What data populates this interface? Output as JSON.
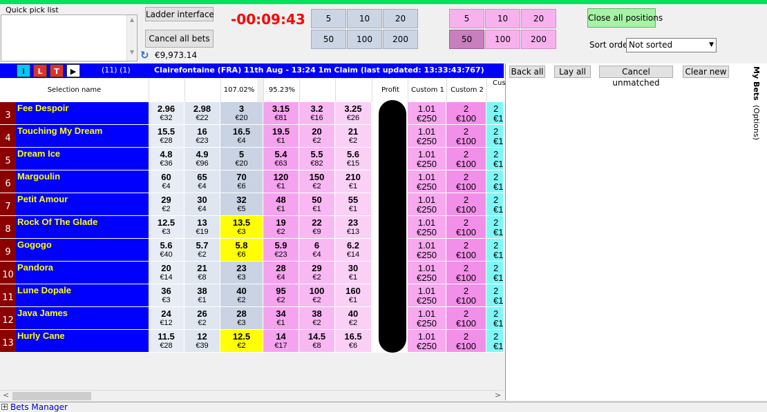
{
  "quick_pick": {
    "label": "Quick pick list"
  },
  "buttons": {
    "ladder": "Ladder interface",
    "cancel_all": "Cancel all bets",
    "close_all": "Close all positions"
  },
  "timer": "-00:09:43",
  "balance": "€9,973.14",
  "back_stakes": [
    "5",
    "10",
    "20",
    "50",
    "100",
    "200"
  ],
  "lay_stakes": [
    "5",
    "10",
    "20",
    "50",
    "100",
    "200"
  ],
  "lay_selected_index": 3,
  "sort": {
    "label": "Sort order",
    "value": "Not sorted"
  },
  "market": {
    "toolbar": [
      "i",
      "L",
      "T",
      "▶"
    ],
    "counts": "(11) (1)",
    "title": "Clairefontaine (FRA) 11th Aug - 13:24 1m Claim (last updated: 13:33:43:767)"
  },
  "columns": {
    "selection": "Selection name",
    "back_book": "107.02%",
    "lay_book": "95.23%",
    "profit": "Profit",
    "custom1": "Custom 1",
    "custom2": "Custom 2",
    "custom3": "Cus"
  },
  "runners": [
    {
      "num": "3",
      "name": "Fee Despoir",
      "back": [
        [
          "2.96",
          "€32"
        ],
        [
          "2.98",
          "€22"
        ],
        [
          "3",
          "€20"
        ]
      ],
      "lay": [
        [
          "3.15",
          "€81"
        ],
        [
          "3.2",
          "€16"
        ],
        [
          "3.25",
          "€26"
        ]
      ],
      "hl": false
    },
    {
      "num": "4",
      "name": "Touching My Dream",
      "back": [
        [
          "15.5",
          "€28"
        ],
        [
          "16",
          "€23"
        ],
        [
          "16.5",
          "€4"
        ]
      ],
      "lay": [
        [
          "19.5",
          "€1"
        ],
        [
          "20",
          "€2"
        ],
        [
          "21",
          "€2"
        ]
      ],
      "hl": false
    },
    {
      "num": "5",
      "name": "Dream Ice",
      "back": [
        [
          "4.8",
          "€36"
        ],
        [
          "4.9",
          "€96"
        ],
        [
          "5",
          "€20"
        ]
      ],
      "lay": [
        [
          "5.4",
          "€63"
        ],
        [
          "5.5",
          "€82"
        ],
        [
          "5.6",
          "€15"
        ]
      ],
      "hl": false
    },
    {
      "num": "6",
      "name": "Margoulin",
      "back": [
        [
          "60",
          "€4"
        ],
        [
          "65",
          "€4"
        ],
        [
          "70",
          "€6"
        ]
      ],
      "lay": [
        [
          "120",
          "€1"
        ],
        [
          "150",
          "€2"
        ],
        [
          "210",
          "€1"
        ]
      ],
      "hl": false
    },
    {
      "num": "7",
      "name": "Petit Amour",
      "back": [
        [
          "29",
          "€2"
        ],
        [
          "30",
          "€4"
        ],
        [
          "32",
          "€5"
        ]
      ],
      "lay": [
        [
          "48",
          "€1"
        ],
        [
          "50",
          "€1"
        ],
        [
          "55",
          "€1"
        ]
      ],
      "hl": false
    },
    {
      "num": "8",
      "name": "Rock Of The Glade",
      "back": [
        [
          "12.5",
          "€3"
        ],
        [
          "13",
          "€19"
        ],
        [
          "13.5",
          "€3"
        ]
      ],
      "lay": [
        [
          "19",
          "€2"
        ],
        [
          "22",
          "€9"
        ],
        [
          "23",
          "€13"
        ]
      ],
      "hl": true
    },
    {
      "num": "9",
      "name": "Gogogo",
      "back": [
        [
          "5.6",
          "€40"
        ],
        [
          "5.7",
          "€2"
        ],
        [
          "5.8",
          "€6"
        ]
      ],
      "lay": [
        [
          "5.9",
          "€23"
        ],
        [
          "6",
          "€4"
        ],
        [
          "6.2",
          "€14"
        ]
      ],
      "hl": true
    },
    {
      "num": "10",
      "name": "Pandora",
      "back": [
        [
          "20",
          "€14"
        ],
        [
          "21",
          "€8"
        ],
        [
          "23",
          "€3"
        ]
      ],
      "lay": [
        [
          "28",
          "€4"
        ],
        [
          "29",
          "€2"
        ],
        [
          "30",
          "€1"
        ]
      ],
      "hl": false
    },
    {
      "num": "11",
      "name": "Lune Dopale",
      "back": [
        [
          "36",
          "€3"
        ],
        [
          "38",
          "€1"
        ],
        [
          "40",
          "€2"
        ]
      ],
      "lay": [
        [
          "95",
          "€2"
        ],
        [
          "100",
          "€2"
        ],
        [
          "160",
          "€1"
        ]
      ],
      "hl": false
    },
    {
      "num": "12",
      "name": "Java James",
      "back": [
        [
          "24",
          "€12"
        ],
        [
          "26",
          "€2"
        ],
        [
          "28",
          "€3"
        ]
      ],
      "lay": [
        [
          "34",
          "€1"
        ],
        [
          "38",
          "€2"
        ],
        [
          "40",
          "€2"
        ]
      ],
      "hl": false
    },
    {
      "num": "13",
      "name": "Hurly Cane",
      "back": [
        [
          "11.5",
          "€28"
        ],
        [
          "12",
          "€39"
        ],
        [
          "12.5",
          "€2"
        ]
      ],
      "lay": [
        [
          "14",
          "€17"
        ],
        [
          "14.5",
          "€8"
        ],
        [
          "16.5",
          "€6"
        ]
      ],
      "hl": true
    }
  ],
  "custom": {
    "c1": [
      "1.01",
      "€250"
    ],
    "c2": [
      "2",
      "€100"
    ],
    "c3": [
      "2",
      "€1"
    ]
  },
  "bets_panel": {
    "back_all": "Back all",
    "lay_all": "Lay all",
    "cancel_unmatched": "Cancel unmatched",
    "clear_new": "Clear new"
  },
  "side_tabs": {
    "my_bets": "My Bets",
    "options": "(Options)"
  },
  "footer": {
    "expand": "+",
    "label": "Bets Manager"
  },
  "scroll": {
    "left": "<",
    "right": ">"
  },
  "colors": {
    "accent_green": "#00e35a",
    "header_blue": "#0000ff",
    "runner_red": "#8b0000",
    "timer_red": "#ff0000"
  }
}
